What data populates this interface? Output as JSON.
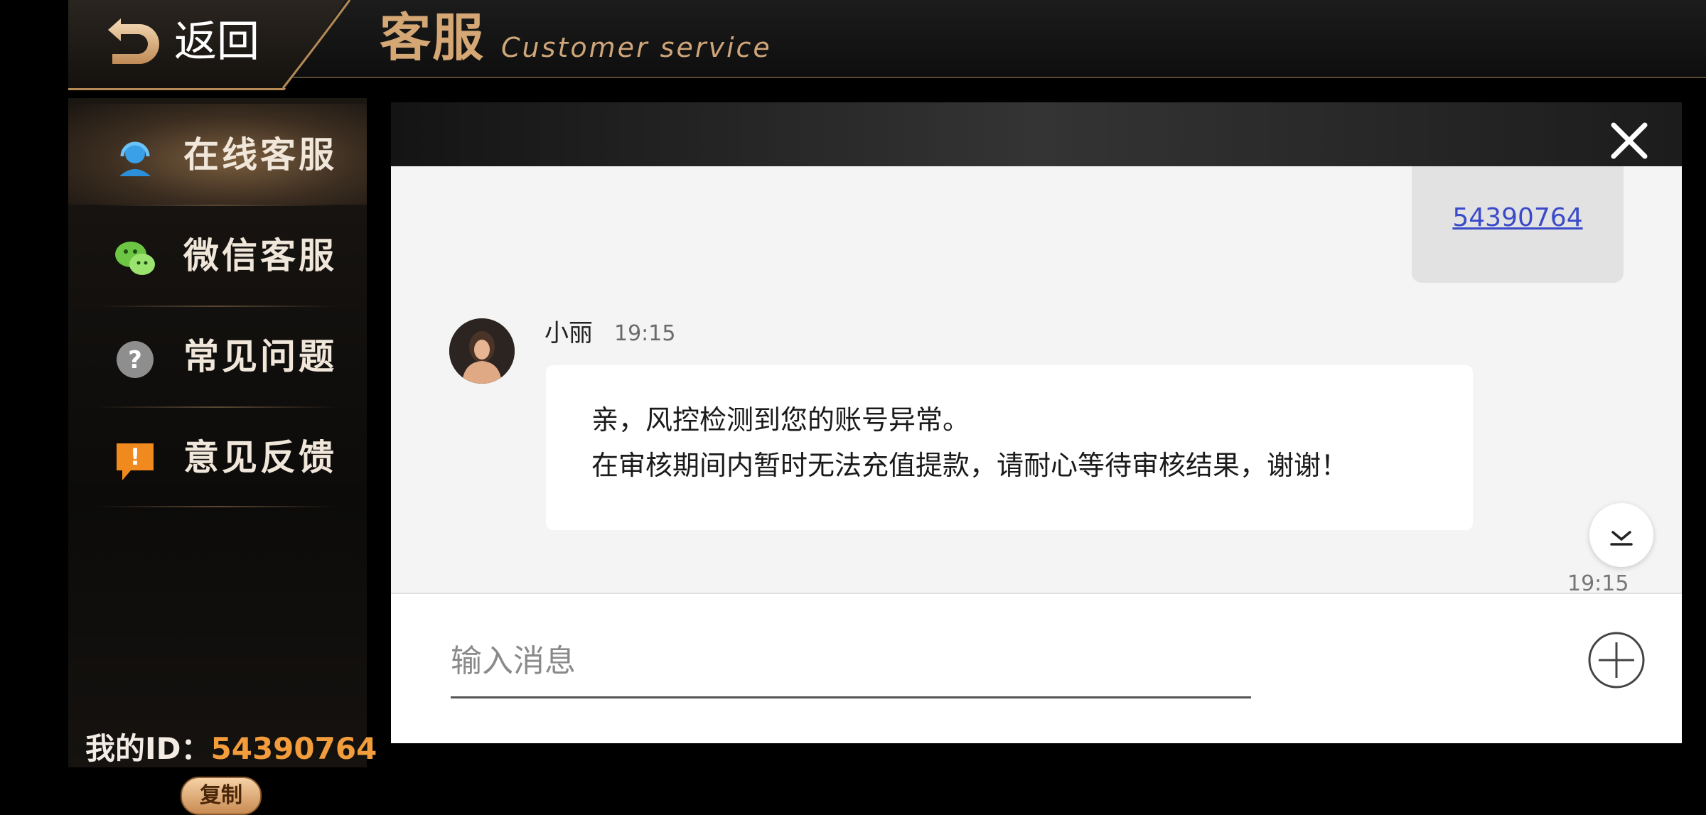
{
  "header": {
    "back_label": "返回",
    "title": "客服",
    "subtitle": "Customer service"
  },
  "sidebar": {
    "items": [
      {
        "label": "在线客服",
        "icon": "headset-icon",
        "active": true
      },
      {
        "label": "微信客服",
        "icon": "wechat-icon",
        "active": false
      },
      {
        "label": "常见问题",
        "icon": "question-icon",
        "active": false
      },
      {
        "label": "意见反馈",
        "icon": "feedback-icon",
        "active": false
      }
    ],
    "my_id_label": "我的ID：",
    "my_id_value": "54390764",
    "copy_label": "复制"
  },
  "chat": {
    "my_message": "54390764",
    "agent": {
      "name": "小丽",
      "time": "19:15",
      "lines": [
        "亲，风控检测到您的账号异常。",
        "在审核期间内暂时无法充值提款，请耐心等待审核结果，谢谢！"
      ]
    },
    "bottom_time": "19:15",
    "input_placeholder": "输入消息"
  },
  "colors": {
    "accent_gold": "#d4a774",
    "id_orange": "#f29c3b",
    "link_blue": "#3a4ac9"
  }
}
